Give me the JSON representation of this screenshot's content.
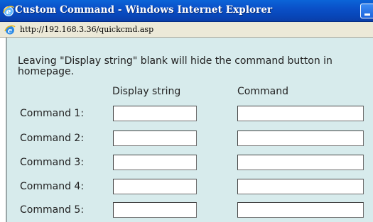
{
  "window": {
    "title": "Custom Command - Windows Internet Explorer",
    "address": "http://192.168.3.36/quickcmd.asp"
  },
  "page": {
    "notice": "Leaving \"Display string\" blank will hide the command button in homepage.",
    "columns": {
      "display": "Display string",
      "command": "Command"
    },
    "rows": [
      {
        "label": "Command 1:",
        "display_value": "",
        "command_value": ""
      },
      {
        "label": "Command 2:",
        "display_value": "",
        "command_value": ""
      },
      {
        "label": "Command 3:",
        "display_value": "",
        "command_value": ""
      },
      {
        "label": "Command 4:",
        "display_value": "",
        "command_value": ""
      },
      {
        "label": "Command 5:",
        "display_value": "",
        "command_value": ""
      }
    ]
  },
  "icons": {
    "title": "internet-explorer-icon",
    "address": "ie-page-icon",
    "window_button": "minimize-icon"
  },
  "colors": {
    "titlebar": "#0a50c8",
    "content_background": "#d7ebec"
  }
}
